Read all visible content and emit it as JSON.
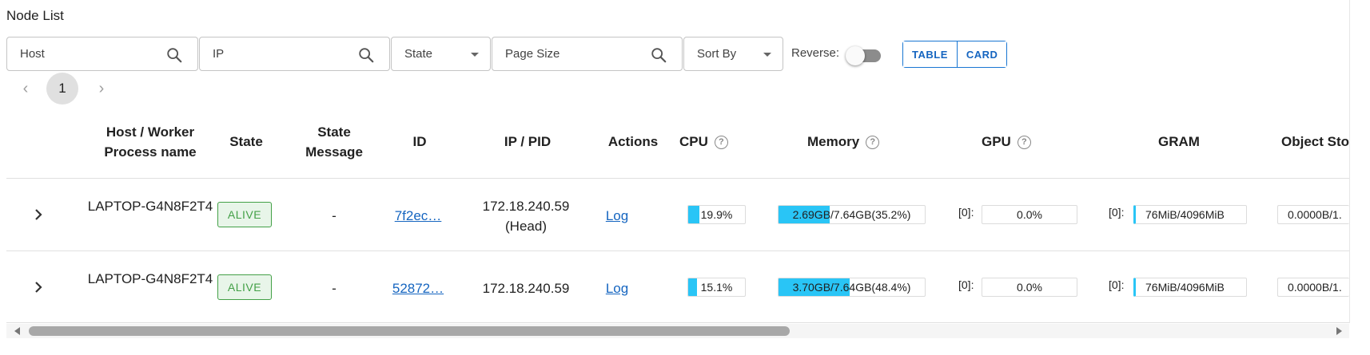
{
  "title": "Node List",
  "filters": {
    "host_label": "Host",
    "ip_label": "IP",
    "state_label": "State",
    "page_size_label": "Page Size",
    "sort_by_label": "Sort By",
    "reverse_label": "Reverse:",
    "reverse_on": false,
    "view_table": "TABLE",
    "view_card": "CARD"
  },
  "pagination": {
    "current": "1",
    "prev_icon": "chevron-left-icon",
    "next_icon": "chevron-right-icon"
  },
  "columns": {
    "host": "Host / Worker Process name",
    "state": "State",
    "state_message": "State Message",
    "id": "ID",
    "ip_pid": "IP / PID",
    "actions": "Actions",
    "cpu": "CPU",
    "memory": "Memory",
    "gpu": "GPU",
    "gram": "GRAM",
    "object_store": "Object Sto"
  },
  "rows": [
    {
      "host": "LAPTOP-G4N8F2T4",
      "state": "ALIVE",
      "state_message": "-",
      "id": "7f2ec…",
      "ip": "172.18.240.59",
      "pid": "(Head)",
      "action": "Log",
      "cpu": "19.9%",
      "cpu_fraction": 0.199,
      "memory_used": "2.69GB",
      "memory_rest": "/7.64GB(35.2%)",
      "memory_fraction": 0.352,
      "gpu_index": "[0]:",
      "gpu": "0.0%",
      "gram_index": "[0]:",
      "gram": "76MiB/4096MiB",
      "object_store": "0.0000B/1."
    },
    {
      "host": "LAPTOP-G4N8F2T4",
      "state": "ALIVE",
      "state_message": "-",
      "id": "52872…",
      "ip": "172.18.240.59",
      "pid": "",
      "action": "Log",
      "cpu": "15.1%",
      "cpu_fraction": 0.151,
      "memory_used": "3.70GB",
      "memory_rest": "/7.64GB(48.4%)",
      "memory_fraction": 0.484,
      "gpu_index": "[0]:",
      "gpu": "0.0%",
      "gram_index": "[0]:",
      "gram": "76MiB/4096MiB",
      "object_store": "0.0000B/1."
    }
  ],
  "colors": {
    "accent": "#1976d2",
    "alive": "#43a047",
    "bar_fill": "#29c5f6"
  }
}
